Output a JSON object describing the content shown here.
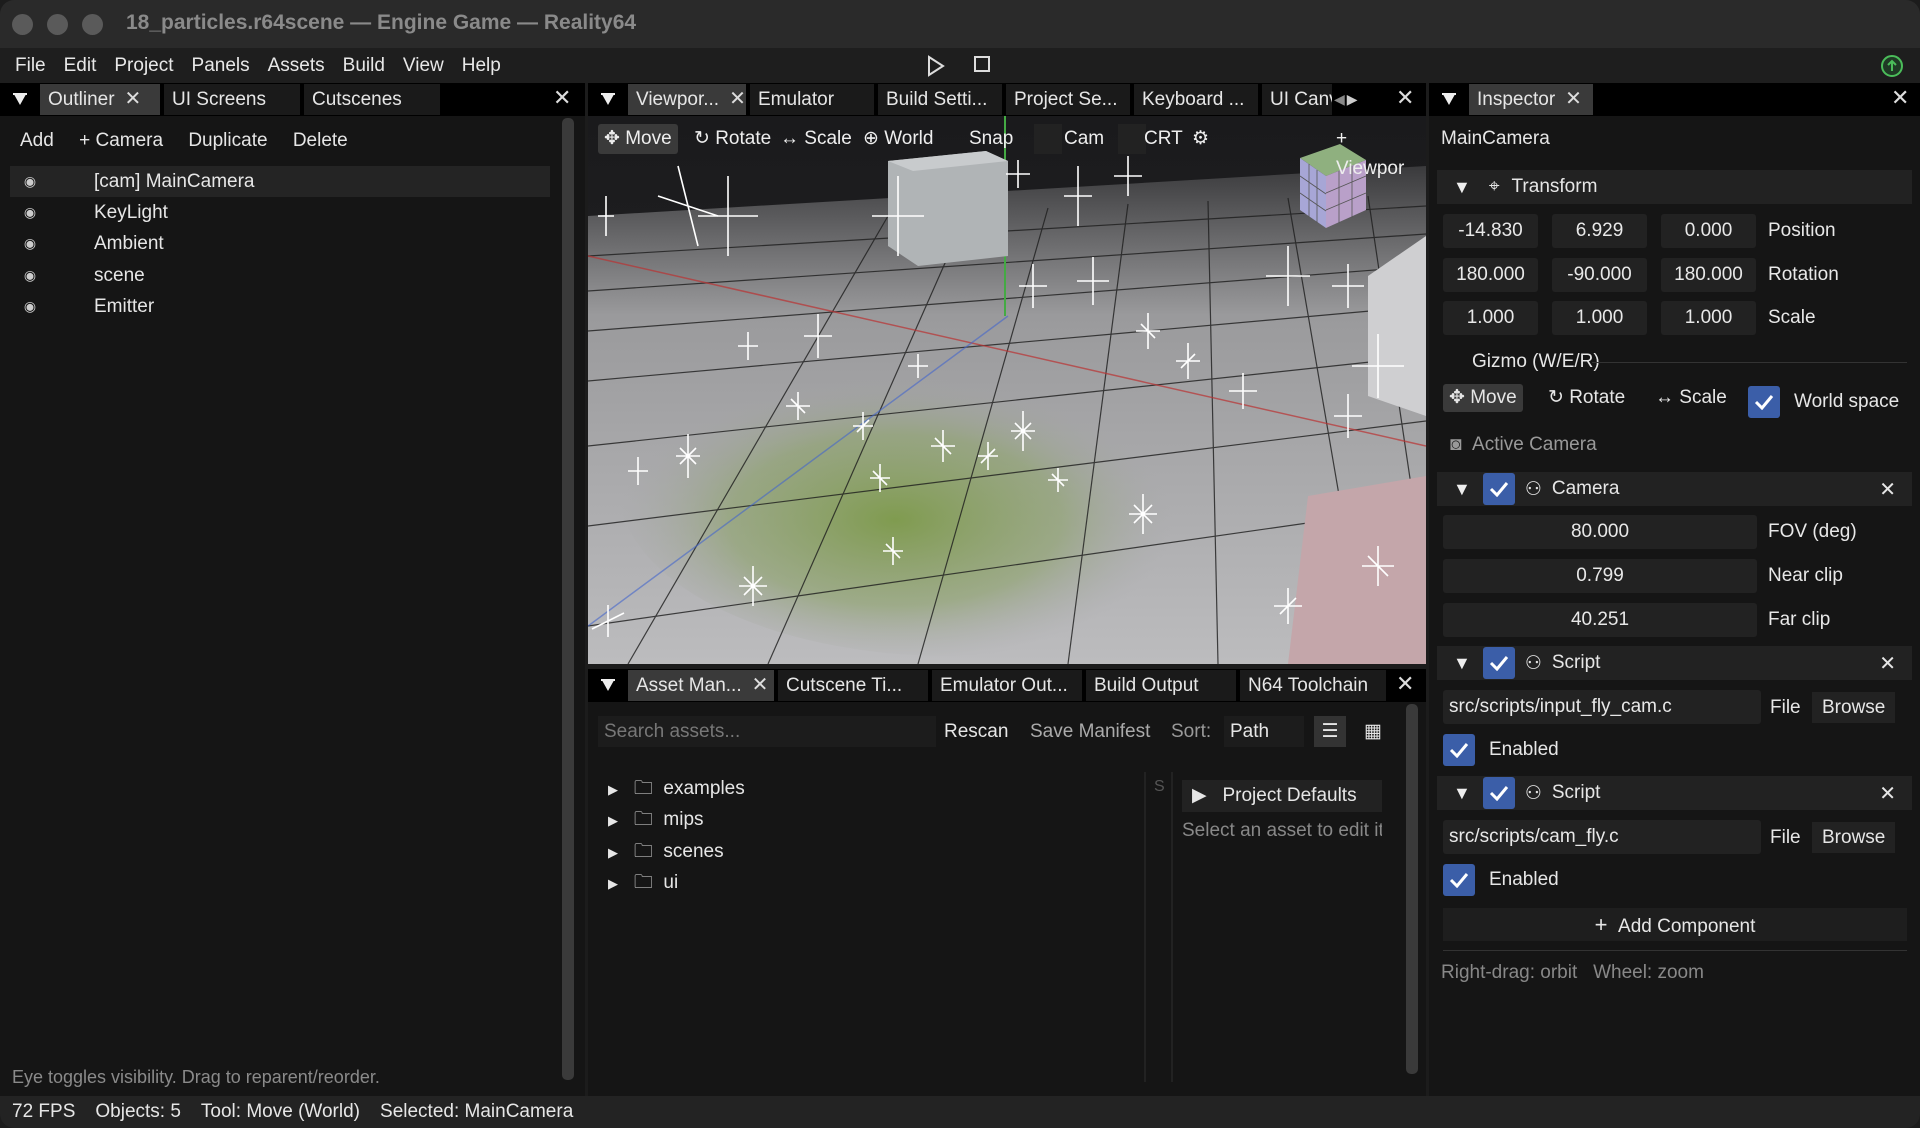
{
  "window": {
    "title": "18_particles.r64scene — Engine Game — Reality64"
  },
  "menu": [
    "File",
    "Edit",
    "Project",
    "Panels",
    "Assets",
    "Build",
    "View",
    "Help"
  ],
  "outliner": {
    "tabs": [
      "Outliner",
      "UI Screens",
      "Cutscenes"
    ],
    "toolbar": [
      "Add",
      "+ Camera",
      "Duplicate",
      "Delete"
    ],
    "items": [
      "[cam] MainCamera",
      "KeyLight",
      "Ambient",
      "scene",
      "Emitter"
    ],
    "hint": "Eye toggles visibility. Drag to reparent/reorder."
  },
  "viewport": {
    "tabs": [
      "Viewpor...",
      "Emulator",
      "Build Setti...",
      "Project Se...",
      "Keyboard ...",
      "UI Canv"
    ],
    "tools": {
      "move": "Move",
      "rotate": "Rotate",
      "scale": "Scale",
      "world": "World",
      "snap": "Snap",
      "cam": "Cam",
      "crt": "CRT",
      "add_viewport": "+ Viewpor"
    }
  },
  "assets": {
    "tabs": [
      "Asset Man...",
      "Cutscene Ti...",
      "Emulator Out...",
      "Build Output",
      "N64 Toolchain"
    ],
    "search_placeholder": "Search assets...",
    "rescan": "Rescan",
    "save_manifest": "Save Manifest",
    "sort_label": "Sort:",
    "sort_value": "Path",
    "folders": [
      "examples",
      "mips",
      "scenes",
      "ui"
    ],
    "right_header": "Project Defaults",
    "right_hint": "Select an asset to edit its",
    "s_marker": "S"
  },
  "inspector": {
    "tab": "Inspector",
    "object_name": "MainCamera",
    "transform": {
      "title": "Transform",
      "position": [
        "-14.830",
        "6.929",
        "0.000"
      ],
      "rotation": [
        "180.000",
        "-90.000",
        "180.000"
      ],
      "scale": [
        "1.000",
        "1.000",
        "1.000"
      ],
      "labels": {
        "position": "Position",
        "rotation": "Rotation",
        "scale": "Scale"
      }
    },
    "gizmo": {
      "title": "Gizmo (W/E/R)",
      "move": "Move",
      "rotate": "Rotate",
      "scale": "Scale",
      "world_space": "World space"
    },
    "active_camera": "Active Camera",
    "camera": {
      "title": "Camera",
      "fov": "80.000",
      "fov_label": "FOV (deg)",
      "near": "0.799",
      "near_label": "Near clip",
      "far": "40.251",
      "far_label": "Far clip"
    },
    "script1": {
      "title": "Script",
      "path": "src/scripts/input_fly_cam.c",
      "file": "File",
      "browse": "Browse",
      "enabled": "Enabled"
    },
    "script2": {
      "title": "Script",
      "path": "src/scripts/cam_fly.c",
      "file": "File",
      "browse": "Browse",
      "enabled": "Enabled"
    },
    "add_component": "Add Component",
    "hint": "Right-drag: orbit   Wheel: zoom"
  },
  "status": {
    "fps": "72 FPS",
    "objects": "Objects: 5",
    "tool": "Tool: Move (World)",
    "selected": "Selected: MainCamera"
  },
  "colors": {
    "accent": "#3b5ea8",
    "bg": "#151515",
    "tab_active": "#3a3a3a"
  }
}
